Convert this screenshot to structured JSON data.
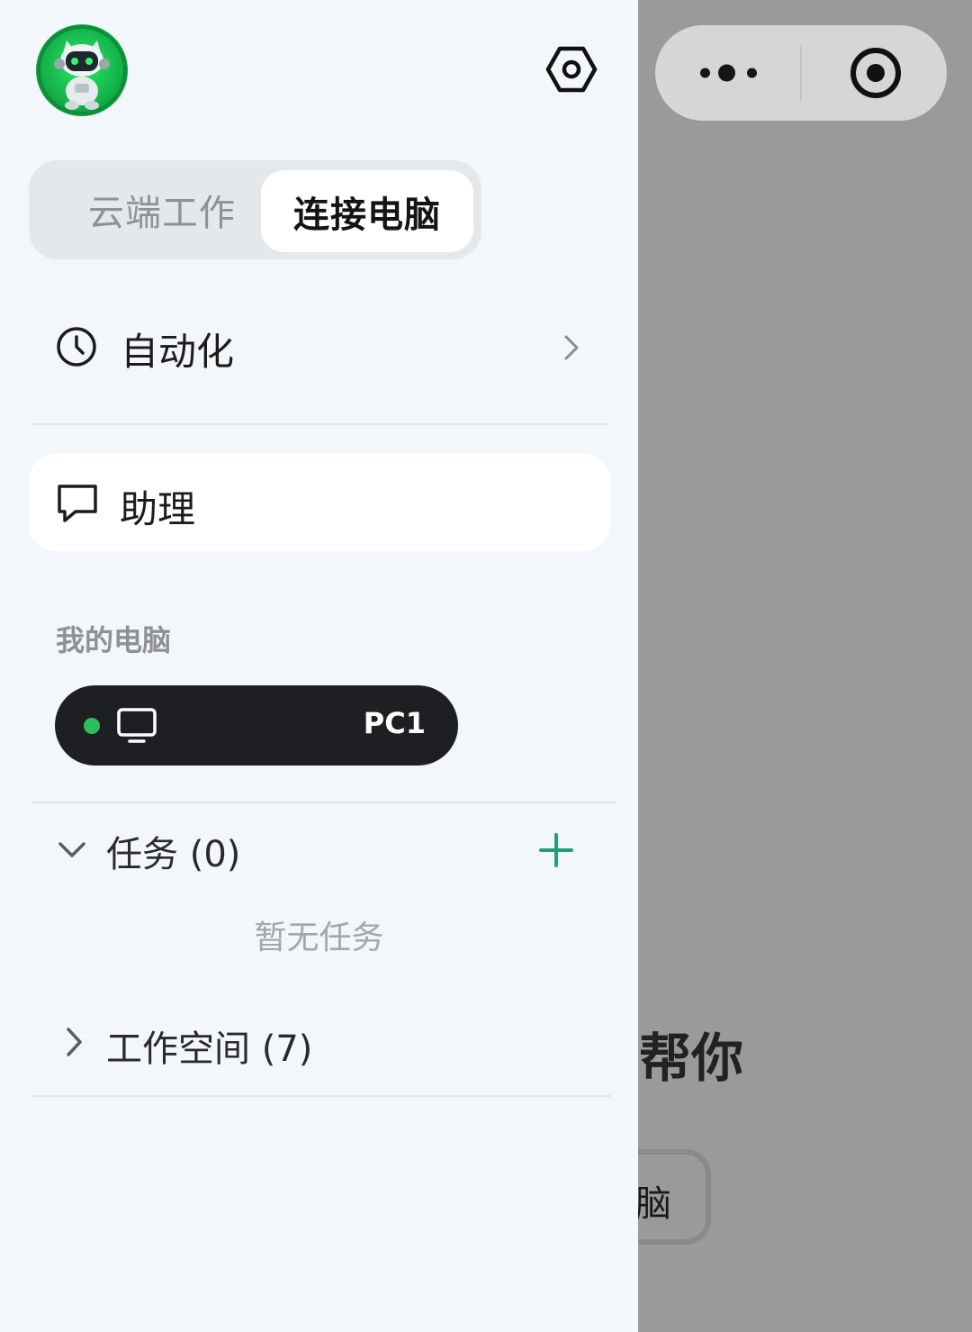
{
  "drawer": {
    "avatar": {
      "icon": "robot-avatar-icon"
    },
    "settings": {
      "icon": "settings-hexagon-icon"
    },
    "segment": {
      "tabs": [
        {
          "label": "云端工作",
          "active": false
        },
        {
          "label": "连接电脑",
          "active": true
        }
      ]
    },
    "automation": {
      "label": "自动化",
      "icon": "clock-icon"
    },
    "assistant": {
      "label": "助理",
      "icon": "chat-bubble-icon"
    },
    "my_pcs": {
      "title": "我的电脑",
      "items": [
        {
          "name": "PC1",
          "status": "online",
          "status_color": "#2fbf5a"
        }
      ]
    },
    "tasks": {
      "label": "任务 (0)",
      "empty_text": "暂无任务",
      "add_color": "#1aa37a"
    },
    "workspaces": {
      "label": "工作空间 (7)"
    }
  },
  "background": {
    "heading_fragment": "帮你",
    "button_fragment": "脑"
  }
}
